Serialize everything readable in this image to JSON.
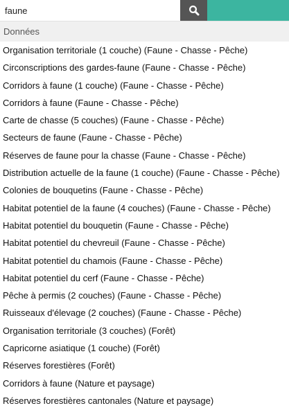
{
  "colors": {
    "search_button_bg": "#555555",
    "accent": "#3cb5a0",
    "group_header_bg": "#f0f0f0"
  },
  "search": {
    "value": "faune",
    "button_icon": "search-icon"
  },
  "results": {
    "group_label": "Données",
    "items": [
      "Organisation territoriale (1 couche) (Faune - Chasse - Pêche)",
      "Circonscriptions des gardes-faune (Faune - Chasse - Pêche)",
      "Corridors à faune (1 couche) (Faune - Chasse - Pêche)",
      "Corridors à faune (Faune - Chasse - Pêche)",
      "Carte de chasse (5 couches) (Faune - Chasse - Pêche)",
      "Secteurs de faune (Faune - Chasse - Pêche)",
      "Réserves de faune pour la chasse (Faune - Chasse - Pêche)",
      "Distribution actuelle de la faune (1 couche) (Faune - Chasse - Pêche)",
      "Colonies de bouquetins (Faune - Chasse - Pêche)",
      "Habitat potentiel de la faune (4 couches) (Faune - Chasse - Pêche)",
      "Habitat potentiel du bouquetin (Faune - Chasse - Pêche)",
      "Habitat potentiel du chevreuil (Faune - Chasse - Pêche)",
      "Habitat potentiel du chamois (Faune - Chasse - Pêche)",
      "Habitat potentiel du cerf (Faune - Chasse - Pêche)",
      "Pêche à permis (2 couches) (Faune - Chasse - Pêche)",
      "Ruisseaux d'élevage (2 couches) (Faune - Chasse - Pêche)",
      "Organisation territoriale (3 couches) (Forêt)",
      "Capricorne asiatique (1 couche) (Forêt)",
      "Réserves forestières (Forêt)",
      "Corridors à faune (Nature et paysage)",
      "Réserves forestières cantonales (Nature et paysage)"
    ]
  }
}
